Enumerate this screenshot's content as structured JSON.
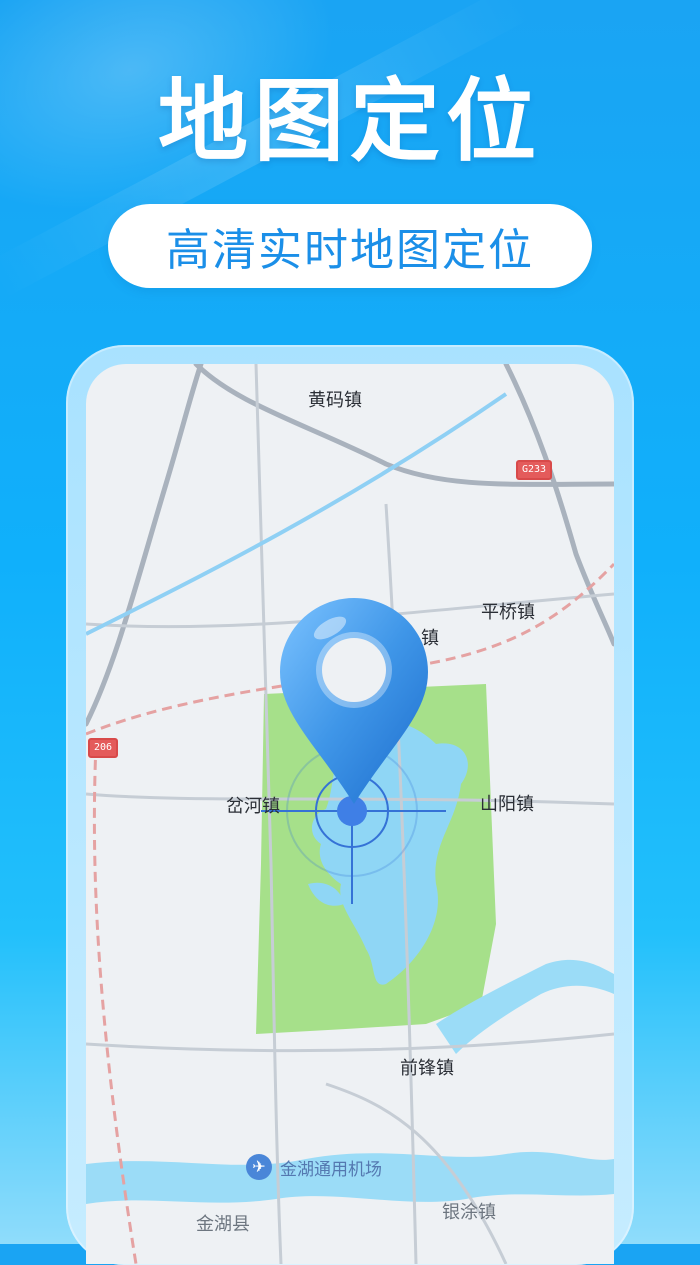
{
  "header": {
    "title": "地图定位",
    "subtitle": "高清实时地图定位"
  },
  "map": {
    "places": {
      "huangma": "黄码镇",
      "pingqiao": "平桥镇",
      "zhen_partial": "镇",
      "chahe": "岔河镇",
      "shanyang": "山阳镇",
      "qianfeng": "前锋镇",
      "jinhu_county": "金湖县",
      "yintu": "银涂镇"
    },
    "airport": "金湖通用机场",
    "road_badges": {
      "g233": "G233",
      "s206": "206"
    }
  },
  "colors": {
    "accent": "#1b8fe8",
    "background": "#10b0fb",
    "park": "#a6e08a",
    "water": "#8fd6f5",
    "pin": "#3f96e8"
  }
}
